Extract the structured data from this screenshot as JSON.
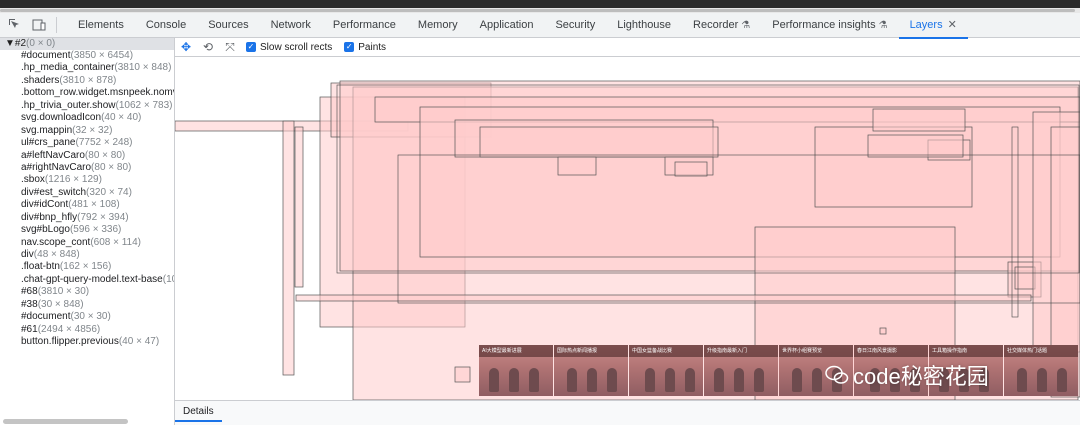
{
  "toolbar_icons": [
    "inspect-element-icon",
    "device-toggle-icon"
  ],
  "tabs": [
    {
      "label": "Elements"
    },
    {
      "label": "Console"
    },
    {
      "label": "Sources"
    },
    {
      "label": "Network"
    },
    {
      "label": "Performance"
    },
    {
      "label": "Memory"
    },
    {
      "label": "Application"
    },
    {
      "label": "Security"
    },
    {
      "label": "Lighthouse"
    },
    {
      "label": "Recorder"
    },
    {
      "label": "Performance insights"
    },
    {
      "label": "Layers"
    }
  ],
  "active_tab": "Layers",
  "tree": {
    "root": {
      "name": "#2",
      "dims": "(0 × 0)"
    },
    "items": [
      {
        "name": "#document",
        "dims": "(3850 × 6454)"
      },
      {
        "name": ".hp_media_container",
        "dims": "(3810 × 848)"
      },
      {
        "name": ".shaders",
        "dims": "(3810 × 878)"
      },
      {
        "name": ".bottom_row.widget.msnpeek.nomvs",
        "dims": ""
      },
      {
        "name": ".hp_trivia_outer.show",
        "dims": "(1062 × 783)"
      },
      {
        "name": "svg.downloadIcon",
        "dims": "(40 × 40)"
      },
      {
        "name": "svg.mappin",
        "dims": "(32 × 32)"
      },
      {
        "name": "ul#crs_pane",
        "dims": "(7752 × 248)"
      },
      {
        "name": "a#leftNavCaro",
        "dims": "(80 × 80)"
      },
      {
        "name": "a#rightNavCaro",
        "dims": "(80 × 80)"
      },
      {
        "name": ".sbox",
        "dims": "(1216 × 129)"
      },
      {
        "name": "div#est_switch",
        "dims": "(320 × 74)"
      },
      {
        "name": "div#idCont",
        "dims": "(481 × 108)"
      },
      {
        "name": "div#bnp_hfly",
        "dims": "(792 × 394)"
      },
      {
        "name": "svg#bLogo",
        "dims": "(596 × 336)"
      },
      {
        "name": "nav.scope_cont",
        "dims": "(608 × 114)"
      },
      {
        "name": "div",
        "dims": "(48 × 848)"
      },
      {
        "name": ".float-btn",
        "dims": "(162 × 156)"
      },
      {
        "name": ".chat-gpt-query-model.text-base",
        "dims": "(10"
      },
      {
        "name": "#68",
        "dims": "(3810 × 30)"
      },
      {
        "name": "#38",
        "dims": "(30 × 848)"
      },
      {
        "name": "#document",
        "dims": "(30 × 30)"
      },
      {
        "name": "#61",
        "dims": "(2494 × 4856)"
      },
      {
        "name": "button.flipper.previous",
        "dims": "(40 × 47)"
      }
    ]
  },
  "layers_toolbar": {
    "tools": [
      "pan-mode-icon",
      "rotate-mode-icon",
      "reset-transform-icon"
    ],
    "slow_scroll_rects": {
      "label": "Slow scroll rects",
      "checked": true
    },
    "paints": {
      "label": "Paints",
      "checked": true
    }
  },
  "thumbnails": [
    {
      "caption": "AI大模型最新进展"
    },
    {
      "caption": "国际热点新闻播报"
    },
    {
      "caption": "中国女篮备战比赛"
    },
    {
      "caption": "升级指南最新入门"
    },
    {
      "caption": "世界杯小组赛预览"
    },
    {
      "caption": "春日江南风景摄影"
    },
    {
      "caption": "工具箱操作指南"
    },
    {
      "caption": "社交媒体热门话题"
    }
  ],
  "watermark": {
    "text": "code秘密花园"
  },
  "details": {
    "tab_label": "Details"
  },
  "colors": {
    "accent": "#1a73e8",
    "layer_fill": "#ffcccc",
    "layer_stroke": "#333333"
  }
}
